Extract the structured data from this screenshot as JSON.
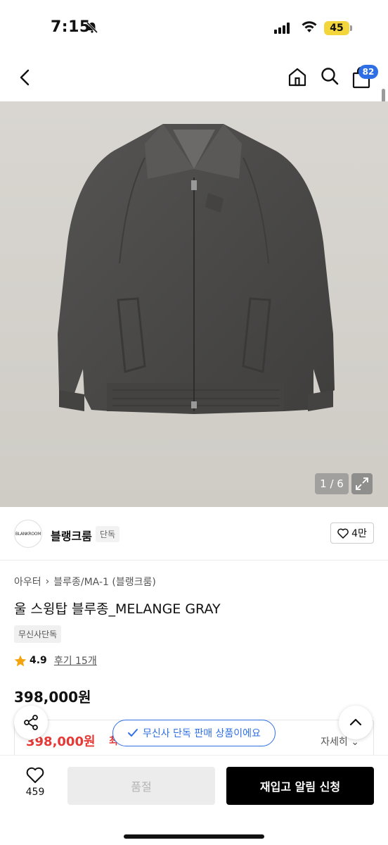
{
  "status_bar": {
    "time": "7:15",
    "battery": "45"
  },
  "nav": {
    "cart_count": "82"
  },
  "gallery": {
    "pager": "1 / 6"
  },
  "brand": {
    "logo_text": "BLANKROOM",
    "name": "블랭크룸",
    "tag": "단독",
    "likes": "4만"
  },
  "product": {
    "breadcrumb": [
      "아우터",
      "블루종/MA-1 (블랭크룸)"
    ],
    "title": "울 스윙탑 블루종_MELANGE GRAY",
    "exclusive_badge": "무신사단독",
    "rating": "4.9",
    "reviews": "후기 15개",
    "price": "398,000원",
    "sale_price": "398,000원",
    "sale_suffix": "최",
    "detail_link": "자세히"
  },
  "toast": {
    "text": "무신사 단독 판매 상품이에요"
  },
  "bottom": {
    "wish_count": "459",
    "soldout_label": "품절",
    "restock_label": "재입고 알림 신청"
  },
  "colors": {
    "accent_blue": "#2f6fe6",
    "sale_red": "#e53935",
    "background_gray": "#d6d3ce",
    "jacket_gray": "#4a4a4a"
  }
}
